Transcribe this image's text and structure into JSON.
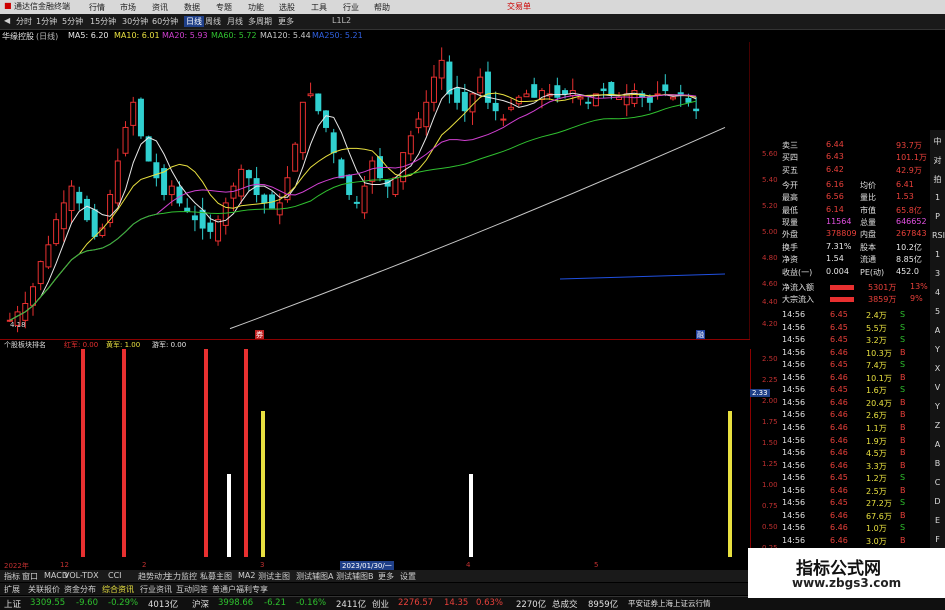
{
  "app": {
    "title": "通达信金融终端",
    "trade_btn": "交易单"
  },
  "nav": [
    "行情",
    "市场",
    "资讯",
    "数据",
    "专题",
    "功能",
    "选股",
    "工具",
    "行业",
    "帮助"
  ],
  "periods": {
    "items": [
      "分时",
      "1分钟",
      "5分钟",
      "15分钟",
      "30分钟",
      "60分钟",
      "日线",
      "周线",
      "月线",
      "多周期",
      "更多"
    ],
    "selected": "日线",
    "extra": "L1L2"
  },
  "stock": {
    "name": "华缘控股",
    "period": "(日线)"
  },
  "ma": [
    {
      "label": "MA5: 6.20",
      "color": "#e8e8e8"
    },
    {
      "label": "MA10: 6.01",
      "color": "#e8e040"
    },
    {
      "label": "MA20: 5.93",
      "color": "#d040d0"
    },
    {
      "label": "MA60: 5.72",
      "color": "#30c030"
    },
    {
      "label": "MA120: 5.44",
      "color": "#c8c8c8"
    },
    {
      "label": "MA250: 5.21",
      "color": "#3060e0"
    }
  ],
  "price_axis": [
    "5.60",
    "5.40",
    "5.20",
    "5.00",
    "4.80",
    "4.60",
    "4.40",
    "4.20"
  ],
  "low_label": "4.18",
  "mark_labels": {
    "a": "券",
    "b": "融"
  },
  "indicator": {
    "name": "个股板块排名",
    "items": [
      {
        "label": "红军: 0.00",
        "color": "#e83030"
      },
      {
        "label": "黄军: 1.00",
        "color": "#e8e040"
      },
      {
        "label": "游军: 0.00",
        "color": "#e8e8e8"
      }
    ],
    "value_tag": "2.33"
  },
  "ind_axis": [
    "2.50",
    "2.25",
    "2.00",
    "1.75",
    "1.50",
    "1.25",
    "1.00",
    "0.75",
    "0.50",
    "0.25"
  ],
  "ind_bars": [
    {
      "pos": 0.108,
      "value": 2.5,
      "color": "#e83030"
    },
    {
      "pos": 0.162,
      "value": 2.5,
      "color": "#e83030"
    },
    {
      "pos": 0.272,
      "value": 2.5,
      "color": "#e83030"
    },
    {
      "pos": 0.303,
      "value": 1.0,
      "color": "#ffffff"
    },
    {
      "pos": 0.325,
      "value": 2.5,
      "color": "#e83030"
    },
    {
      "pos": 0.348,
      "value": 1.75,
      "color": "#e8e040"
    },
    {
      "pos": 0.625,
      "value": 1.0,
      "color": "#ffffff"
    },
    {
      "pos": 0.97,
      "value": 1.75,
      "color": "#e8e040"
    }
  ],
  "dates": {
    "items": [
      "2022年",
      "12",
      "2",
      "3",
      "4",
      "5"
    ],
    "highlight": "2023/01/30/一"
  },
  "quote": [
    {
      "l": "卖三",
      "v": "6.44",
      "c": "red",
      "v2": "93.7万"
    },
    {
      "l": "买四",
      "v": "6.43",
      "c": "red",
      "v2": "101.1万"
    },
    {
      "l": "买五",
      "v": "6.42",
      "c": "red",
      "v2": "42.9万"
    },
    {
      "l": "今开",
      "v": "6.16",
      "c": "red",
      "l2": "均价",
      "v3": "6.41"
    },
    {
      "l": "最高",
      "v": "6.56",
      "c": "red",
      "l2": "量比",
      "v3": "1.53"
    },
    {
      "l": "最低",
      "v": "6.14",
      "c": "red",
      "l2": "市值",
      "v3": "65.8亿"
    },
    {
      "l": "现量",
      "v": "11564",
      "c": "mag",
      "l2": "总量",
      "v3": "646652"
    },
    {
      "l": "外盘",
      "v": "378809",
      "c": "red",
      "l2": "内盘",
      "v3": "267843"
    },
    {
      "l": "换手",
      "v": "7.31%",
      "c": "wht",
      "l2": "股本",
      "v3": "10.2亿"
    },
    {
      "l": "净资",
      "v": "1.54",
      "c": "wht",
      "l2": "流通",
      "v3": "8.85亿"
    },
    {
      "l": "收益(一)",
      "v": "0.004",
      "c": "wht",
      "l2": "PE(动)",
      "v3": "452.0"
    }
  ],
  "flow": [
    {
      "l": "净流入额",
      "v": "5301万",
      "p": "13%"
    },
    {
      "l": "大宗流入",
      "v": "3859万",
      "p": "9%"
    }
  ],
  "ticks": [
    [
      "14:56",
      "6.45",
      "2.4万",
      "S"
    ],
    [
      "14:56",
      "6.45",
      "5.5万",
      "S"
    ],
    [
      "14:56",
      "6.45",
      "3.2万",
      "S"
    ],
    [
      "14:56",
      "6.46",
      "10.3万",
      "B"
    ],
    [
      "14:56",
      "6.45",
      "7.4万",
      "S"
    ],
    [
      "14:56",
      "6.46",
      "10.1万",
      "B"
    ],
    [
      "14:56",
      "6.45",
      "1.6万",
      "S"
    ],
    [
      "14:56",
      "6.46",
      "20.4万",
      "B"
    ],
    [
      "14:56",
      "6.46",
      "2.6万",
      "B"
    ],
    [
      "14:56",
      "6.46",
      "1.1万",
      "B"
    ],
    [
      "14:56",
      "6.46",
      "1.9万",
      "B"
    ],
    [
      "14:56",
      "6.46",
      "4.5万",
      "B"
    ],
    [
      "14:56",
      "6.46",
      "3.3万",
      "B"
    ],
    [
      "14:56",
      "6.45",
      "1.2万",
      "S"
    ],
    [
      "14:56",
      "6.46",
      "2.5万",
      "B"
    ],
    [
      "14:56",
      "6.45",
      "27.2万",
      "S"
    ],
    [
      "14:56",
      "6.46",
      "67.6万",
      "B"
    ],
    [
      "14:56",
      "6.46",
      "1.0万",
      "S"
    ],
    [
      "14:56",
      "6.46",
      "3.0万",
      "B"
    ],
    [
      "14:56",
      "6.47",
      "10.8万",
      "B"
    ],
    [
      "14:56",
      "6.47",
      "19.3万",
      "B"
    ],
    [
      "14:56",
      "6.47",
      "1.3万",
      "B"
    ]
  ],
  "tabs": [
    "指标",
    "窗口",
    "MACD",
    "VOL-TDX",
    "CCI",
    "趋势动力",
    "主力监控",
    "私募主图",
    "MA2",
    "测试主图",
    "测试辅图A",
    "测试辅图B",
    "更多",
    "设置"
  ],
  "tabs2": [
    "扩展",
    "关联报价",
    "资金分布",
    "综合资讯",
    "行业资讯",
    "互动问答",
    "普通户福利专享"
  ],
  "market": [
    {
      "n": "上证",
      "v": "3309.55",
      "d": "-9.60",
      "p": "-0.29%",
      "a": "4013亿"
    },
    {
      "n": "沪深",
      "v": "3998.66",
      "d": "-6.21",
      "p": "-0.16%",
      "a": "2411亿"
    },
    {
      "n": "创业",
      "v": "2276.57",
      "d": "14.35",
      "p": "0.63%",
      "a": "2270亿"
    }
  ],
  "total": {
    "label": "总成交",
    "value": "8959亿",
    "broker": "平安证券上海上证云行情"
  },
  "watermark": {
    "title": "指标公式网",
    "url": "www.zbgs3.com"
  },
  "side_labels": [
    "中",
    "对",
    "拍",
    "1",
    "P",
    "RSI",
    "1",
    "3",
    "4",
    "5",
    "A",
    "Y",
    "X",
    "V",
    "Y",
    "Z",
    "A",
    "B",
    "C",
    "D",
    "E",
    "F",
    "G"
  ],
  "corner": "模板",
  "panel_label": "交交F10"
}
